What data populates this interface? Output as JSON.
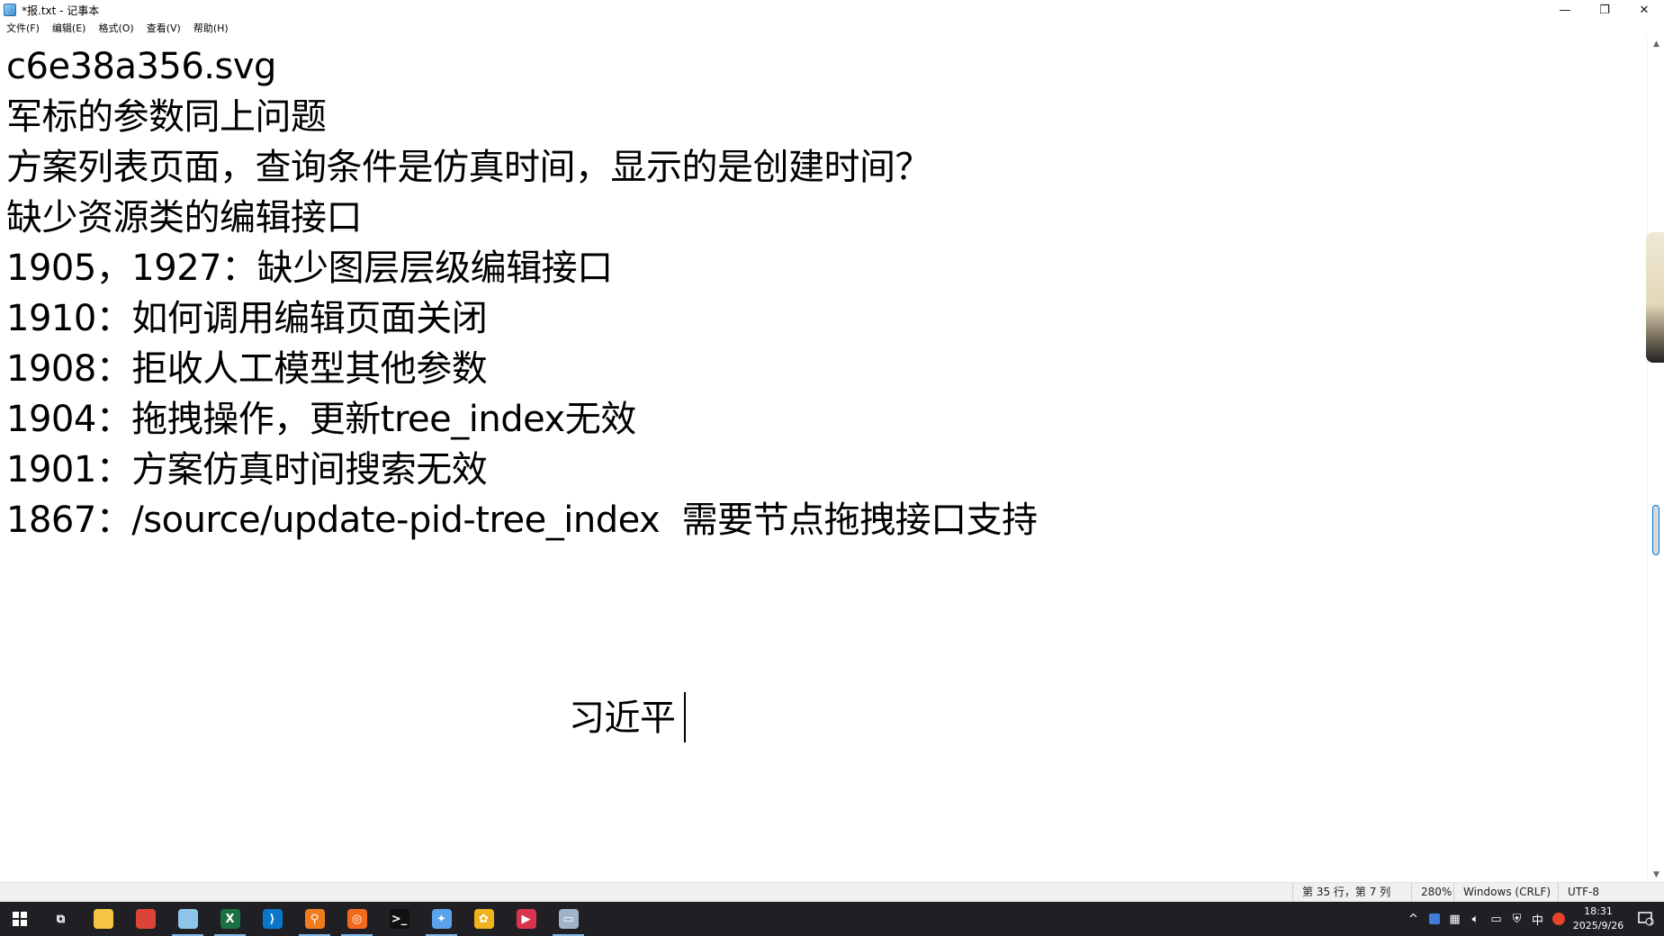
{
  "window": {
    "title": "*报.txt - 记事本",
    "minimize_glyph": "—",
    "restore_glyph": "❐",
    "close_glyph": "✕"
  },
  "menu": [
    "文件(F)",
    "编辑(E)",
    "格式(O)",
    "查看(V)",
    "帮助(H)"
  ],
  "editor": {
    "lines": [
      "c6e38a356.svg",
      "军标的参数同上问题",
      "方案列表页面，查询条件是仿真时间，显示的是创建时间？",
      "缺少资源类的编辑接口",
      "1905，1927：缺少图层层级编辑接口",
      "1910：如何调用编辑页面关闭",
      "1908：拒收人工模型其他参数",
      "1904：拖拽操作，更新tree_index无效",
      "1901：方案仿真时间搜索无效",
      "1867：/source/update-pid-tree_index  需要节点拖拽接口支持"
    ],
    "cursor_line_text": "习近平"
  },
  "statusbar": {
    "position": "第 35 行，第 7 列",
    "zoom": "280%",
    "line_ending": "Windows (CRLF)",
    "encoding": "UTF-8"
  },
  "taskbar": {
    "apps": [
      {
        "name": "task-view",
        "glyph": "⧉",
        "color": "#1f1f24",
        "active": false
      },
      {
        "name": "file-explorer",
        "glyph": "",
        "color": "#f4c542",
        "active": false
      },
      {
        "name": "chrome",
        "glyph": "",
        "color": "#db4437",
        "active": false
      },
      {
        "name": "notepad",
        "glyph": "",
        "color": "#8fc4ea",
        "active": true
      },
      {
        "name": "excel",
        "glyph": "X",
        "color": "#1d7044",
        "active": true
      },
      {
        "name": "vscode",
        "glyph": "⟩",
        "color": "#0a76c9",
        "active": false
      },
      {
        "name": "search-tool",
        "glyph": "⚲",
        "color": "#f07c1e",
        "active": true
      },
      {
        "name": "orange-app",
        "glyph": "◎",
        "color": "#f26b1d",
        "active": true
      },
      {
        "name": "terminal",
        "glyph": ">_",
        "color": "#111111",
        "active": false
      },
      {
        "name": "compass-app",
        "glyph": "✦",
        "color": "#5aa3ea",
        "active": true
      },
      {
        "name": "paw-app",
        "glyph": "✿",
        "color": "#f0b21c",
        "active": false
      },
      {
        "name": "media-player",
        "glyph": "▶",
        "color": "#d9344f",
        "active": false
      },
      {
        "name": "remote-app",
        "glyph": "▭",
        "color": "#9fb4c9",
        "active": true
      }
    ],
    "tray": {
      "chevron": "^",
      "ime": "中",
      "time": "18:31",
      "date": "2025/9/26",
      "notification_count": "1"
    }
  }
}
